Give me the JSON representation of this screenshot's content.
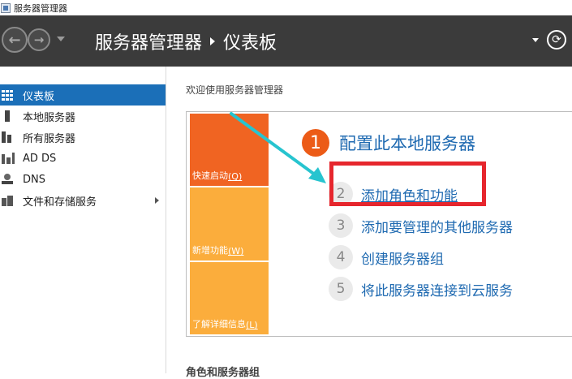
{
  "window": {
    "title": "服务器管理器"
  },
  "header": {
    "breadcrumb_root": "服务器管理器",
    "breadcrumb_current": "仪表板",
    "back_glyph": "←",
    "forward_glyph": "→",
    "refresh_glyph": "⟳"
  },
  "sidebar": {
    "items": [
      {
        "label": "仪表板",
        "icon": "dashboard-icon",
        "active": true
      },
      {
        "label": "本地服务器",
        "icon": "server-icon"
      },
      {
        "label": "所有服务器",
        "icon": "servers-icon"
      },
      {
        "label": "AD DS",
        "icon": "ad-ds-icon"
      },
      {
        "label": "DNS",
        "icon": "dns-icon"
      },
      {
        "label": "文件和存储服务",
        "icon": "storage-icon",
        "has_submenu": true
      }
    ]
  },
  "main": {
    "welcome": "欢迎使用服务器管理器",
    "tiles": [
      {
        "label": "快速启动",
        "accel": "(Q)",
        "color": "#f06422"
      },
      {
        "label": "新增功能",
        "accel": "(W)",
        "color": "#fbad3c"
      },
      {
        "label": "了解详细信息",
        "accel": "(L)",
        "color": "#fbad3c"
      }
    ],
    "steps": [
      {
        "num": "1",
        "label": "配置此本地服务器"
      },
      {
        "num": "2",
        "label": "添加角色和功能"
      },
      {
        "num": "3",
        "label": "添加要管理的其他服务器"
      },
      {
        "num": "4",
        "label": "创建服务器组"
      },
      {
        "num": "5",
        "label": "将此服务器连接到云服务"
      }
    ],
    "roles_heading": "角色和服务器组"
  },
  "colors": {
    "header_bg": "#3b3b3b",
    "accent_blue": "#1b6fb8",
    "link_blue": "#1f6ab1",
    "orange": "#f06422",
    "amber": "#fbad3c",
    "highlight_red": "#e6262d",
    "annotation_cyan": "#27c4cf"
  }
}
